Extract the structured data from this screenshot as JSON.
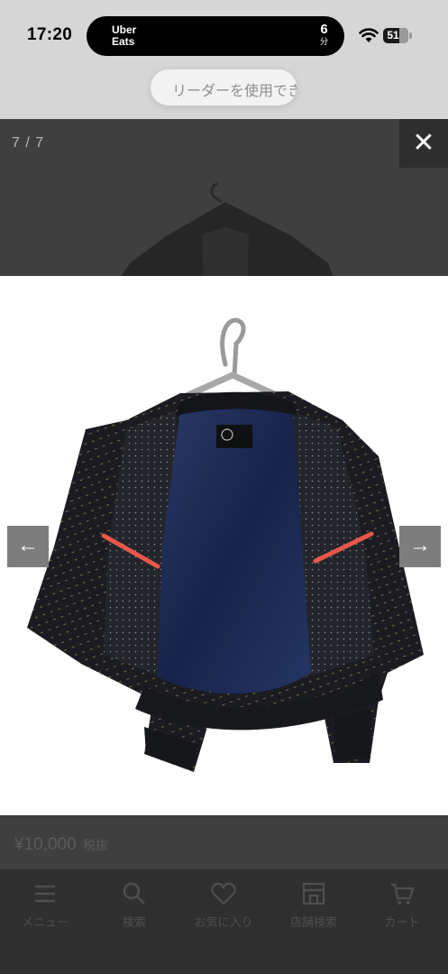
{
  "status_bar": {
    "time": "17:20",
    "app_line1": "Uber",
    "app_line2": "Eats",
    "eta_value": "6",
    "eta_unit": "分",
    "battery": "51",
    "reader_prompt": "リーダーを使用でき"
  },
  "viewer": {
    "counter": "7 / 7",
    "close_symbol": "✕",
    "prev_symbol": "←",
    "next_symbol": "→"
  },
  "product": {
    "price": "¥10,000",
    "tax_label": "税抜"
  },
  "bottom_nav": {
    "items": [
      {
        "label": "メニュー",
        "icon": "menu-icon"
      },
      {
        "label": "検索",
        "icon": "search-icon"
      },
      {
        "label": "お気に入り",
        "icon": "heart-icon"
      },
      {
        "label": "店舗検索",
        "icon": "store-icon"
      },
      {
        "label": "カート",
        "icon": "cart-icon"
      }
    ]
  },
  "colors": {
    "overlay": "#3f3f3f",
    "status_bar": "#d6d6d6",
    "arrow_bg": "#7d7d7d",
    "jacket": "#1b1e24",
    "lining": "#1c2a4f",
    "pocket_trim": "#e8584a"
  }
}
